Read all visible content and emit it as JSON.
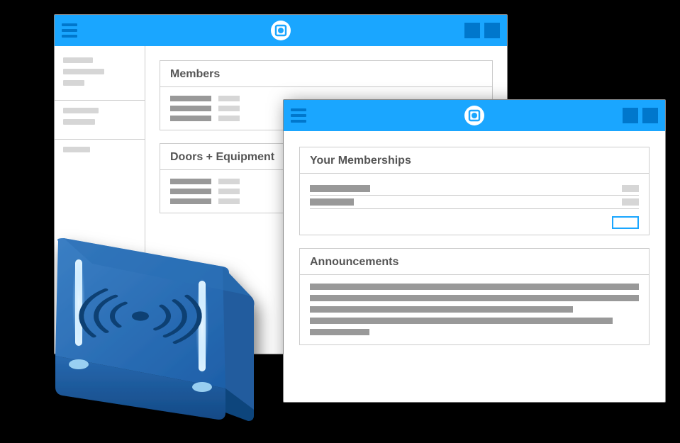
{
  "backWindow": {
    "cards": {
      "members": {
        "title": "Members"
      },
      "doors": {
        "title": "Doors + Equipment"
      }
    }
  },
  "frontWindow": {
    "cards": {
      "memberships": {
        "title": "Your Memberships"
      },
      "announcements": {
        "title": "Announcements"
      }
    }
  }
}
